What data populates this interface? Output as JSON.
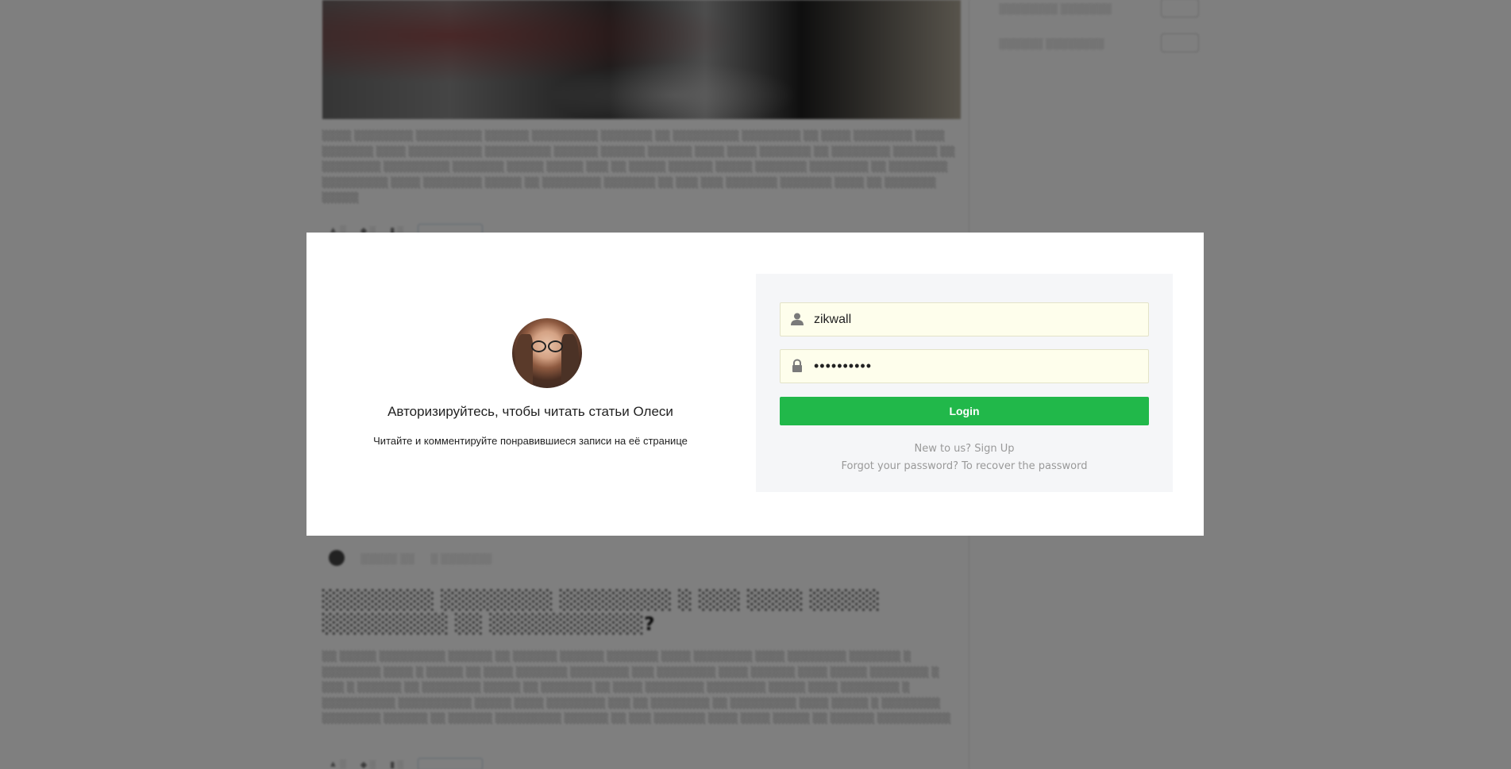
{
  "modal": {
    "heading": "Авторизируйтесь, чтобы читать статьи Олеси",
    "subtext": "Читайте и комментируйте понравившиеся записи на её странице",
    "username_value": "zikwall",
    "password_value": "••••••••••",
    "login_label": "Login",
    "signup_link": "New to us? Sign Up",
    "recover_link": "Forgot your password? To recover the password",
    "avatar_icon": "user-avatar-photo",
    "username_icon": "user-icon",
    "password_icon": "lock-icon"
  },
  "colors": {
    "login_button": "#21b84a",
    "field_bg": "#fefeec",
    "panel_bg": "#f5f6f8",
    "overlay": "rgba(0,0,0,0.5)"
  }
}
